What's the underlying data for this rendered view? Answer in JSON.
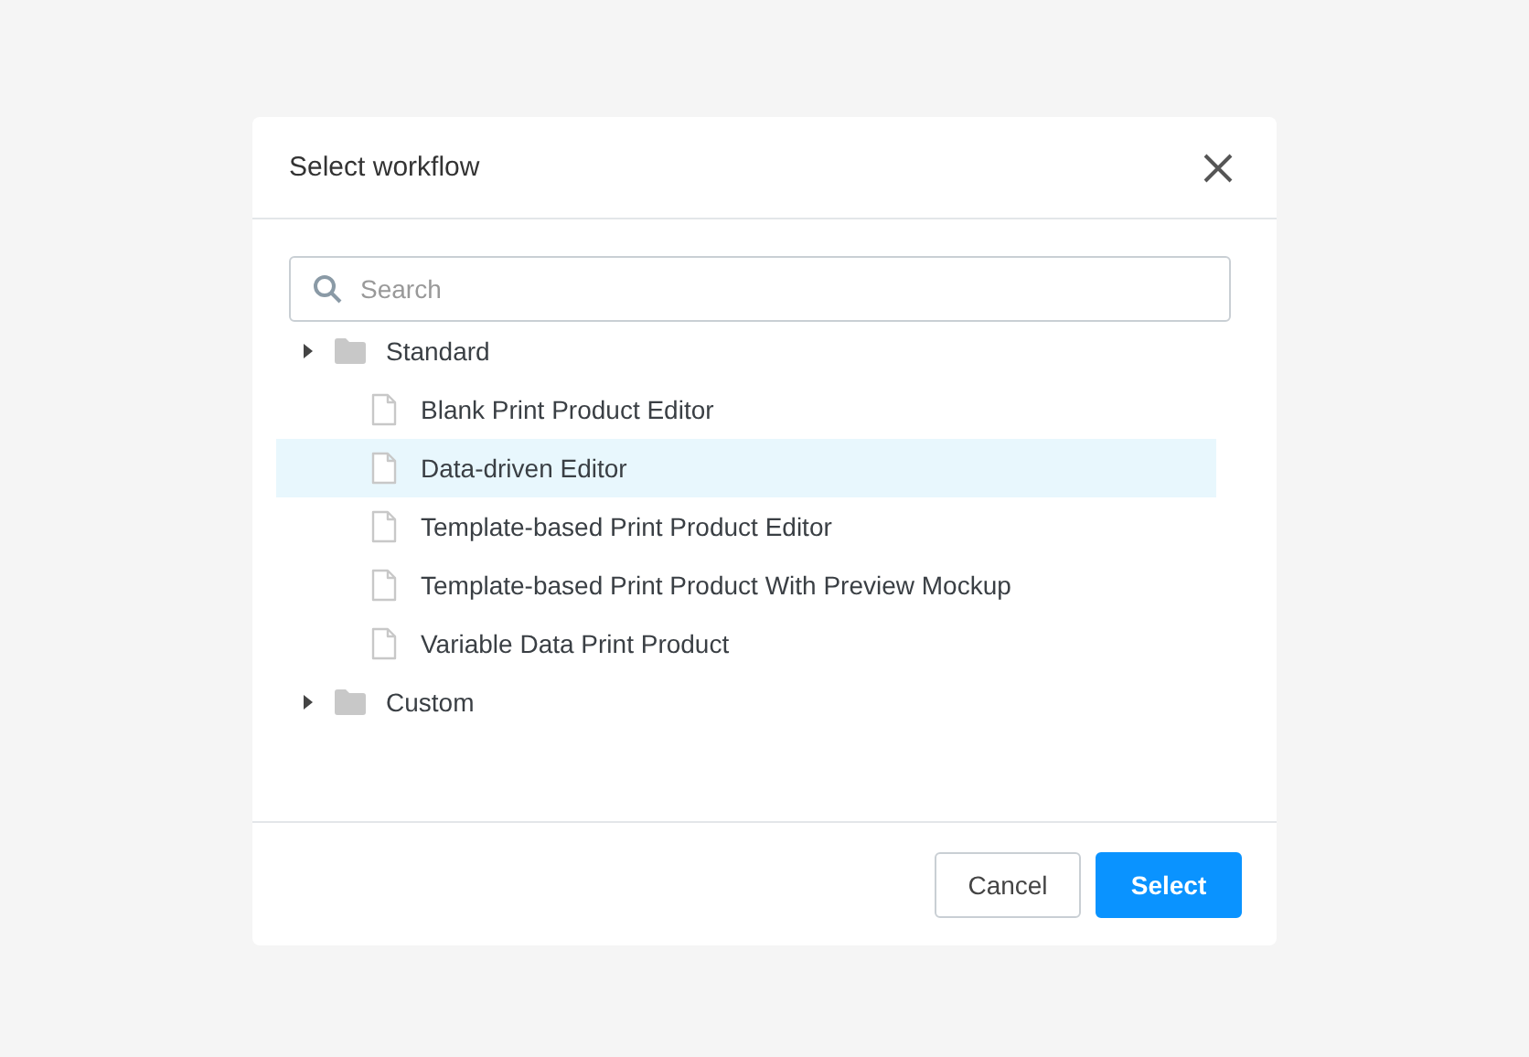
{
  "dialog": {
    "title": "Select workflow",
    "search": {
      "placeholder": "Search"
    },
    "tree": [
      {
        "label": "Standard",
        "kind": "folder",
        "children": [
          {
            "label": "Blank Print Product Editor",
            "kind": "file",
            "selected": false
          },
          {
            "label": "Data-driven Editor",
            "kind": "file",
            "selected": true
          },
          {
            "label": "Template-based Print Product Editor",
            "kind": "file",
            "selected": false
          },
          {
            "label": "Template-based Print Product With Preview Mockup",
            "kind": "file",
            "selected": false
          },
          {
            "label": "Variable Data Print Product",
            "kind": "file",
            "selected": false
          }
        ]
      },
      {
        "label": "Custom",
        "kind": "folder"
      }
    ],
    "buttons": [
      {
        "label": "Cancel",
        "kind": "secondary"
      },
      {
        "label": "Select",
        "kind": "primary"
      }
    ]
  }
}
